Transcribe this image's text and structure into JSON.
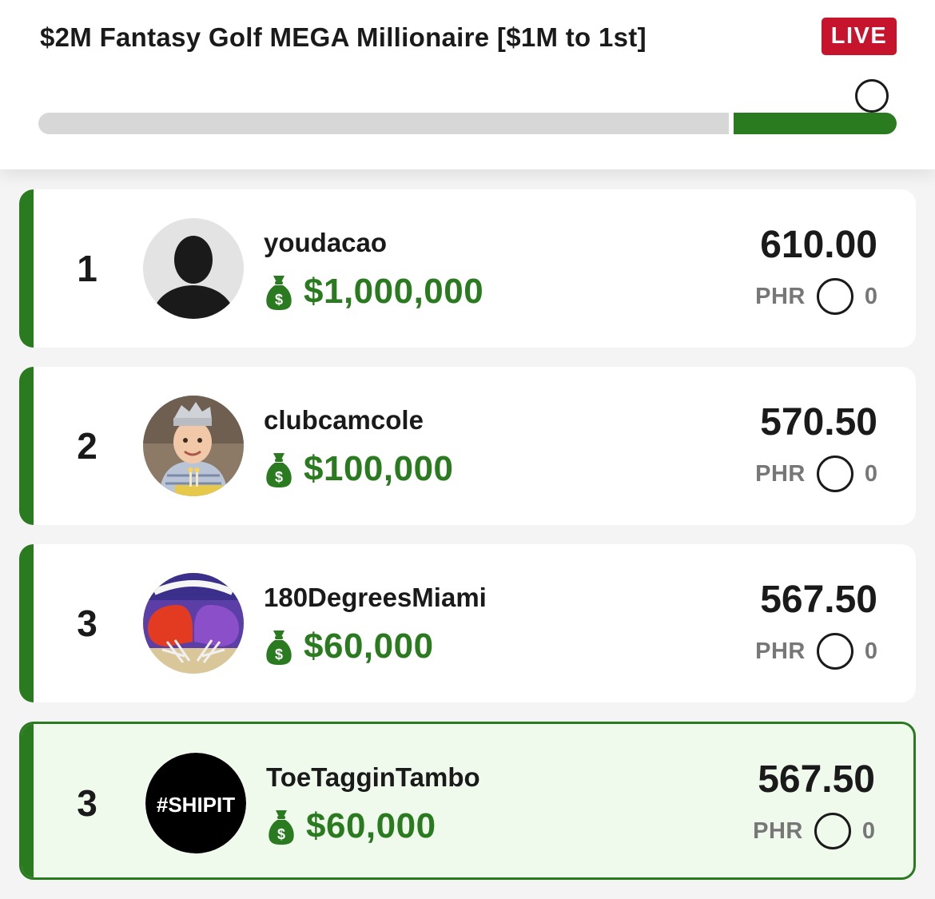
{
  "header": {
    "title": "$2M Fantasy Golf MEGA Millionaire [$1M to 1st]",
    "status_badge": "LIVE",
    "progress_fraction_complete": 0.19,
    "colors": {
      "accent_green": "#2a7a1f",
      "live_red": "#c5142c"
    }
  },
  "leaderboard": [
    {
      "rank": "1",
      "username": "youdacao",
      "prize": "$1,000,000",
      "points": "610.00",
      "phr_label": "PHR",
      "phr_value": "0",
      "avatar": "default-silhouette-avatar",
      "is_current_user": false
    },
    {
      "rank": "2",
      "username": "clubcamcole",
      "prize": "$100,000",
      "points": "570.50",
      "phr_label": "PHR",
      "phr_value": "0",
      "avatar": "child-photo-avatar",
      "is_current_user": false
    },
    {
      "rank": "3",
      "username": "180DegreesMiami",
      "prize": "$60,000",
      "points": "567.50",
      "phr_label": "PHR",
      "phr_value": "0",
      "avatar": "football-helmets-avatar",
      "is_current_user": false
    },
    {
      "rank": "3",
      "username": "ToeTagginTambo",
      "prize": "$60,000",
      "points": "567.50",
      "phr_label": "PHR",
      "phr_value": "0",
      "avatar": "shipit-text-avatar",
      "avatar_text": "#SHIPIT",
      "is_current_user": true
    }
  ]
}
